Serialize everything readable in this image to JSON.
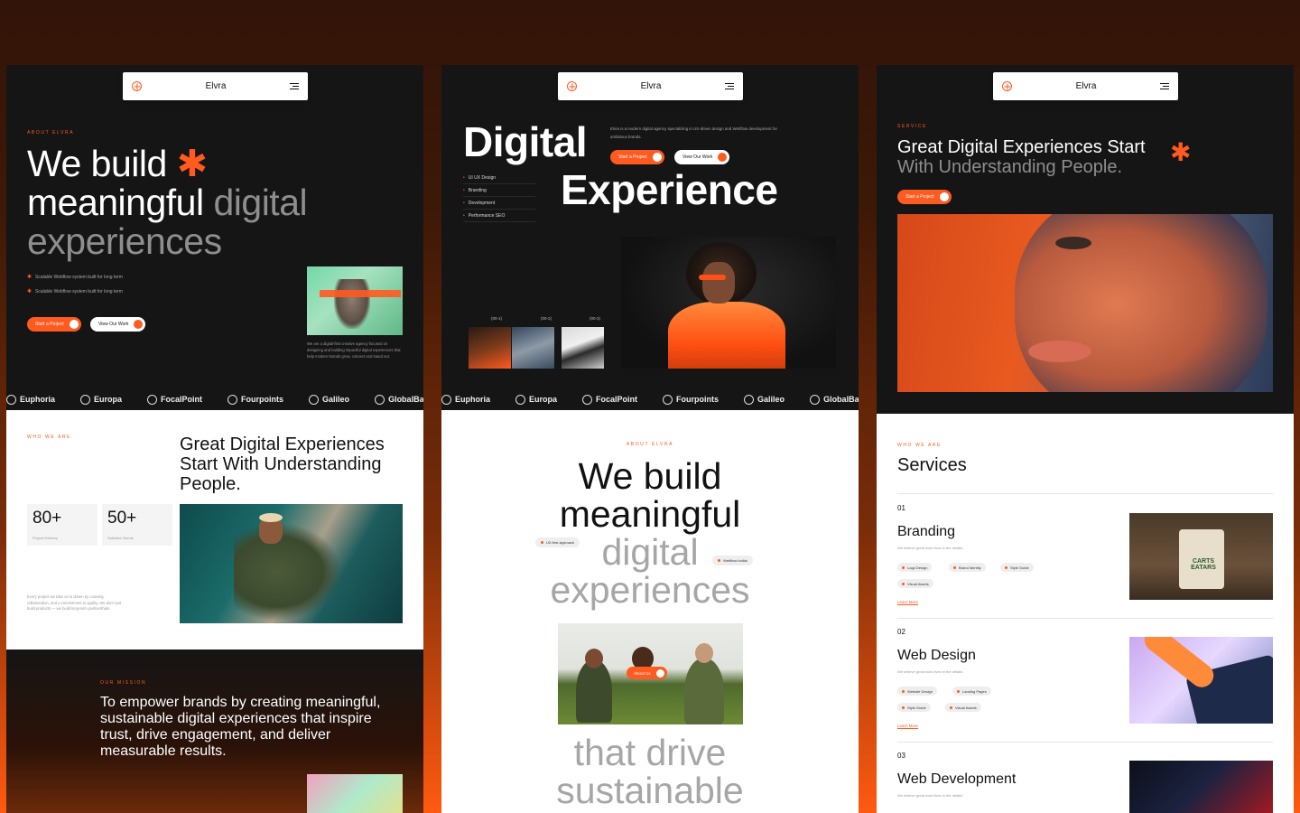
{
  "brand": "Elvra",
  "marquee": [
    "Euphoria",
    "Europa",
    "FocalPoint",
    "Fourpoints",
    "Galileo",
    "GlobalBank"
  ],
  "panel1": {
    "eyebrow": "About Elvra",
    "headline_line1": "We build",
    "headline_line2a": "meaningful",
    "headline_line2b": "digital",
    "headline_line3": "experiences",
    "bullets": [
      "Scalable Webflow system built for long term",
      "Scalable Webflow system built for long term"
    ],
    "btn_primary": "Start a Project",
    "btn_secondary": "View Our Work",
    "caption": "We are a digital-first creative agency focused on designing and building impactful digital experiences that help modern brands grow, connect and stand out.",
    "who_eyebrow": "Who we are",
    "who_title": "Great Digital Experiences Start With Understanding People.",
    "stats": [
      {
        "value": "80+",
        "label": "Project Delivery"
      },
      {
        "value": "50+",
        "label": "Satisfied Clients"
      }
    ],
    "who_text": "Every project we take on is driven by curiosity, collaboration, and a commitment to quality. We don't just build products — we build long-term partnerships.",
    "mission_eyebrow": "Our Mission",
    "mission_text": "To empower brands by creating meaningful, sustainable digital experiences that inspire trust, drive engagement, and deliver measurable results."
  },
  "panel2": {
    "word1": "Digital",
    "word2": "Experience",
    "desc": "Elvra is a modern digital agency specializing in UX-driven design and Webflow development for ambitious brands.",
    "btn_primary": "Start a Project",
    "btn_secondary": "View Our Work",
    "services": [
      "UI UX Design",
      "Branding",
      "Development",
      "Performance SEO"
    ],
    "thumb_labels": [
      "(00-1)",
      "(00-2)",
      "(00-3)"
    ],
    "about_eyebrow": "About Elvra",
    "big_line1": "We build",
    "big_line2": "meaningful",
    "big_line3": "digital",
    "big_line4": "experiences",
    "chip_left": "UX-first approach",
    "chip_right": "Webflow builds",
    "about_btn": "About Us",
    "big_line5": "that drive",
    "big_line6": "sustainable"
  },
  "panel3": {
    "eyebrow": "Service",
    "headline_a": "Great Digital Experiences Start",
    "headline_b": "With Understanding People.",
    "btn_primary": "Start a Project",
    "who_eyebrow": "Who we are",
    "services_title": "Services",
    "services": [
      {
        "num": "01",
        "title": "Branding",
        "sub": "We believe great work lives in the details.",
        "tags": [
          "Logo Design",
          "Brand Identity",
          "Style Guide",
          "Visual Assets"
        ],
        "learn": "Learn More"
      },
      {
        "num": "02",
        "title": "Web Design",
        "sub": "We believe great work lives in the details.",
        "tags": [
          "Website Design",
          "Landing Pages",
          "Style Guide",
          "Visual Assets"
        ],
        "learn": "Learn More"
      },
      {
        "num": "03",
        "title": "Web Development",
        "sub": "We believe great work lives in the details.",
        "tags": [],
        "learn": ""
      }
    ],
    "bag_text": "CARTS EATARS"
  },
  "colors": {
    "accent": "#ff5a1f",
    "dark": "#151515",
    "light": "#ffffff"
  }
}
